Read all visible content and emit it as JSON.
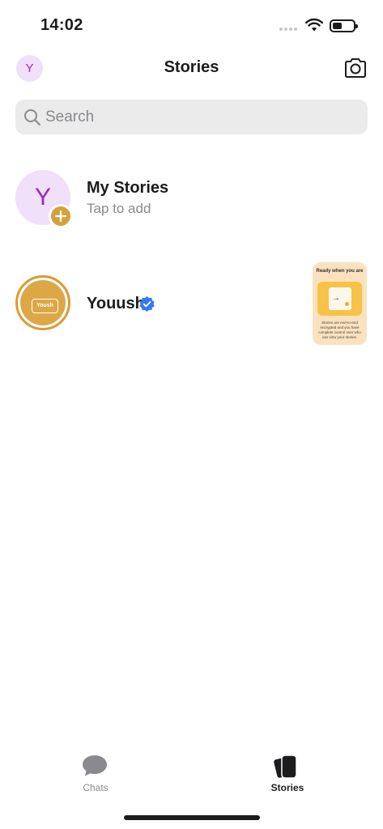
{
  "status_bar": {
    "time": "14:02"
  },
  "header": {
    "avatar_letter": "Y",
    "title": "Stories"
  },
  "search": {
    "placeholder": "Search"
  },
  "my_stories": {
    "avatar_letter": "Y",
    "title": "My Stories",
    "subtitle": "Tap to add"
  },
  "stories": [
    {
      "name": "Youush",
      "verified": true,
      "avatar_text": "Yoush",
      "thumbnail": {
        "title": "Ready when you are",
        "body": "Stories are end-to-end encrypted and you have complete control over who can view your stories."
      }
    }
  ],
  "tabs": [
    {
      "label": "Chats",
      "icon": "chat-bubble-icon",
      "active": false
    },
    {
      "label": "Stories",
      "icon": "stories-icon",
      "active": true
    }
  ],
  "colors": {
    "accent": "#d6a13c",
    "avatar_bg": "#f1e0fa",
    "avatar_fg": "#9b25c9",
    "verified": "#3478f6"
  }
}
